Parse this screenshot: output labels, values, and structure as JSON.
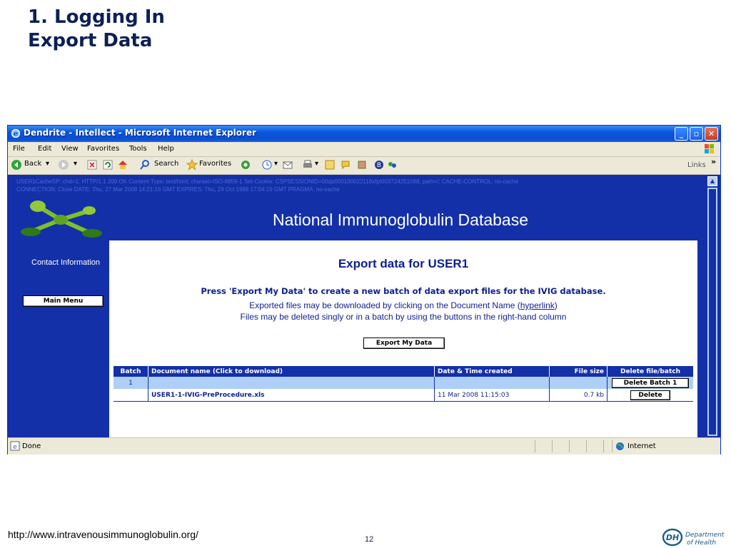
{
  "slide": {
    "title_line1": "1. Logging In",
    "title_line2": "Export Data",
    "footer_url": "http://www.intravenousimmunoglobulin.org/",
    "page_number": "12",
    "logo": {
      "abbr": "DH",
      "line1": "Department",
      "line2": "of Health"
    }
  },
  "browser": {
    "window_title": "Dendrite - Intellect - Microsoft Internet Explorer",
    "menu": [
      "File",
      "Edit",
      "View",
      "Favorites",
      "Tools",
      "Help"
    ],
    "toolbar": {
      "back": "Back",
      "search": "Search",
      "favorites": "Favorites",
      "links": "Links"
    },
    "status": {
      "left": "Done",
      "zone": "Internet"
    }
  },
  "page": {
    "header_line1": "USER1CacheSP: chd=1; HTTP/1.1 200 OK Content-Type: text/html; charset=ISO-8859-1 Set-Cookie: CSPSESSIONID=00dp000100022118xfpt003724251088; path=/; CACHE-CONTROL: no-cache",
    "header_line2": "CONNECTION: Close DATE: Thu, 27 Mar 2008 14:21:16 GMT EXPIRES: Thu, 29 Oct 1998 17:04:19 GMT PRAGMA: no-cache",
    "site_title": "National Immunoglobulin Database",
    "sidebar": {
      "contact": "Contact Information",
      "main_menu": "Main Menu"
    },
    "heading": "Export data for USER1",
    "instruction": "Press 'Export My Data' to create a new batch of data export files for the IVIG database.",
    "info_line1_pre": "Exported files may be downloaded by clicking on the Document Name (",
    "info_line1_link": "hyperlink",
    "info_line1_post": ")",
    "info_line2": "Files may be deleted singly or in a batch by using the buttons in the right-hand column",
    "export_button": "Export My Data",
    "table": {
      "headers": [
        "Batch",
        "Document name   (Click to download)",
        "Date & Time created",
        "File size",
        "Delete file/batch"
      ],
      "batch": {
        "number": "1",
        "delete_label": "Delete Batch 1"
      },
      "file": {
        "name": "USER1-1-IVIG-PreProcedure.xls",
        "created": "11 Mar 2008   11:15:03",
        "size": "0.7 kb",
        "delete_label": "Delete"
      }
    }
  },
  "colors": {
    "page_blue": "#1330a8",
    "text_navy": "#0d1f8f",
    "batch_row": "#aecff7",
    "title_navy": "#0d1f57"
  }
}
